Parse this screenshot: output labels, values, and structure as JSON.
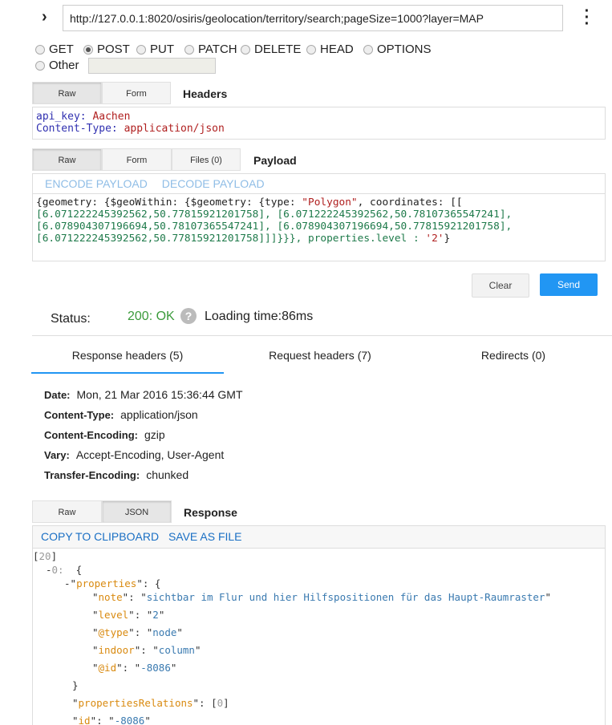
{
  "request": {
    "url": "http://127.0.0.1:8020/osiris/geolocation/territory/search;pageSize=1000?layer=MAP",
    "methods": [
      "GET",
      "POST",
      "PUT",
      "PATCH",
      "DELETE",
      "HEAD",
      "OPTIONS"
    ],
    "selected_method": "POST",
    "other_label": "Other",
    "other_value": "",
    "headers_tabs": [
      "Raw",
      "Form"
    ],
    "headers_title": "Headers",
    "headers": [
      {
        "key": "api_key:",
        "value": "Aachen"
      },
      {
        "key": "Content-Type:",
        "value": "application/json"
      }
    ],
    "payload_tabs": [
      "Raw",
      "Form",
      "Files (0)"
    ],
    "payload_title": "Payload",
    "encode_label": "ENCODE PAYLOAD",
    "decode_label": "DECODE PAYLOAD",
    "payload": {
      "l1a": "{geometry: {$geoWithin: {$geometry: {type: ",
      "l1b": "\"Polygon\"",
      "l1c": ", coordinates: [[",
      "l2": "[6.071222245392562,50.77815921201758], [6.071222245392562,50.78107365547241],",
      "l3": "[6.078904307196694,50.78107365547241], [6.078904307196694,50.77815921201758],",
      "l4a": "[6.071222245392562,50.77815921201758]]]}}}, properties.level : ",
      "l4b": "'2'",
      "l4c": "}"
    },
    "clear_label": "Clear",
    "send_label": "Send"
  },
  "status": {
    "label": "Status:",
    "code": "200: OK",
    "loading": "Loading time:86ms"
  },
  "tabs": [
    "Response headers (5)",
    "Request headers (7)",
    "Redirects (0)"
  ],
  "response_headers": [
    {
      "k": "Date:",
      "v": "Mon, 21 Mar 2016 15:36:44 GMT"
    },
    {
      "k": "Content-Type:",
      "v": "application/json"
    },
    {
      "k": "Content-Encoding:",
      "v": "gzip"
    },
    {
      "k": "Vary:",
      "v": "Accept-Encoding, User-Agent"
    },
    {
      "k": "Transfer-Encoding:",
      "v": "chunked"
    }
  ],
  "response": {
    "tabs": [
      "Raw",
      "JSON"
    ],
    "title": "Response",
    "copy_label": "COPY TO CLIPBOARD",
    "save_label": "SAVE AS FILE",
    "count": "20",
    "index": "0:",
    "properties_key": "properties",
    "props": [
      {
        "k": "note",
        "v": "sichtbar im Flur und hier Hilfspositionen für das Haupt-Raumraster"
      },
      {
        "k": "level",
        "v": "2"
      },
      {
        "k": "@type",
        "v": "node"
      },
      {
        "k": "indoor",
        "v": "column"
      },
      {
        "k": "@id",
        "v": "-8086"
      }
    ],
    "relations_key": "propertiesRelations",
    "relations_count": "0",
    "id_key": "id",
    "id_value": "-8086"
  },
  "colors": {
    "accent": "#2196f3",
    "status_ok": "#3a9a3a",
    "link": "#1a6fc4"
  }
}
